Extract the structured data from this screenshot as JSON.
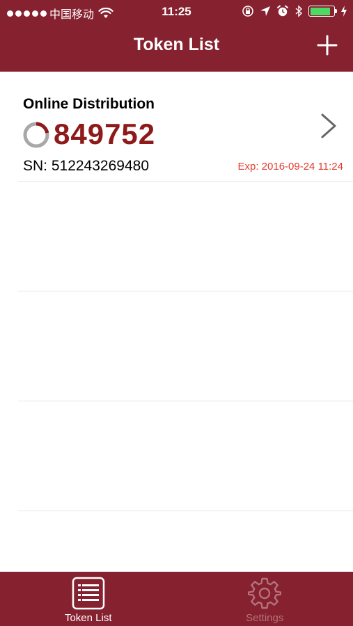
{
  "status_bar": {
    "carrier": "中国移动",
    "time": "11:25",
    "battery_level": 0.85
  },
  "nav": {
    "title": "Token List",
    "add_icon": "plus-icon"
  },
  "tokens": [
    {
      "name": "Online Distribution",
      "code": "849752",
      "sn": "SN: 512243269480",
      "expiry": "Exp: 2016-09-24 11:24",
      "timer_progress": 0.22
    }
  ],
  "tab_bar": {
    "tabs": [
      {
        "label": "Token List",
        "icon": "list-icon",
        "active": true
      },
      {
        "label": "Settings",
        "icon": "gear-icon",
        "active": false
      }
    ]
  },
  "colors": {
    "brand": "#86212f",
    "code": "#8e1a1a",
    "expiry": "#e23b2e",
    "battery": "#4cd964"
  }
}
